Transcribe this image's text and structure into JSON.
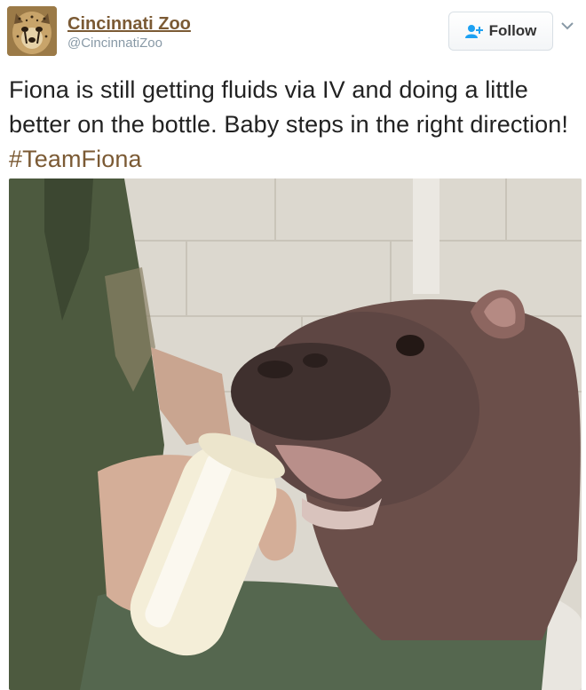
{
  "account": {
    "name": "Cincinnati Zoo",
    "handle": "@CincinnatiZoo",
    "avatar_icon": "cheetah-avatar-icon"
  },
  "actions": {
    "follow_label": "Follow",
    "follow_icon": "add-user-icon",
    "menu_icon": "chevron-down-icon"
  },
  "tweet": {
    "text": "Fiona is still getting fluids via IV and doing a little better on the bottle. Baby steps in the right direction!",
    "hashtag": "#TeamFiona"
  },
  "colors": {
    "name": "#7b5a34",
    "hashtag": "#7b5a34",
    "handle": "#8899a6",
    "follow_icon": "#1da1f2"
  }
}
